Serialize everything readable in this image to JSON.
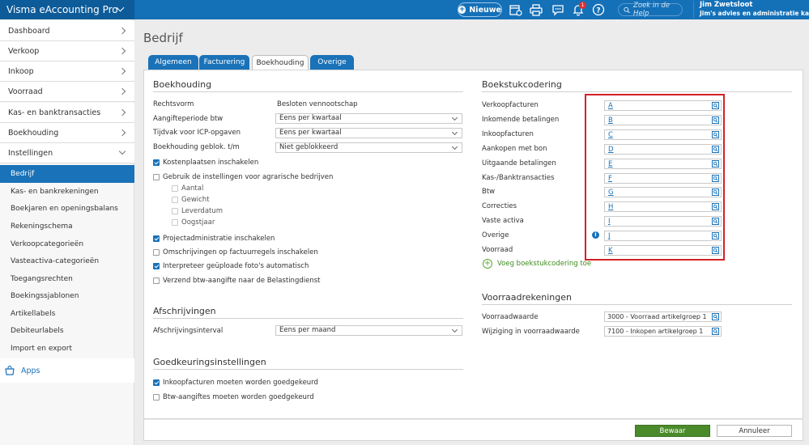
{
  "app": {
    "title": "Visma eAccounting Pro"
  },
  "topbar": {
    "new_label": "Nieuwe",
    "notification_count": "1",
    "search_placeholder": "Zoek in de Help",
    "user_name": "Jim Zwetsloot",
    "company": "Jim's advies en administratie kantoor"
  },
  "sidebar": {
    "top_items": [
      {
        "label": "Dashboard"
      },
      {
        "label": "Verkoop"
      },
      {
        "label": "Inkoop"
      },
      {
        "label": "Voorraad"
      },
      {
        "label": "Kas- en banktransacties"
      },
      {
        "label": "Boekhouding"
      },
      {
        "label": "Instellingen"
      }
    ],
    "sub_items": [
      {
        "label": "Bedrijf",
        "active": true
      },
      {
        "label": "Kas- en bankrekeningen"
      },
      {
        "label": "Boekjaren en openingsbalans"
      },
      {
        "label": "Rekeningschema"
      },
      {
        "label": "Verkoopcategorieën"
      },
      {
        "label": "Vasteactiva-categorieën"
      },
      {
        "label": "Toegangsrechten"
      },
      {
        "label": "Boekingssjablonen"
      },
      {
        "label": "Artikellabels"
      },
      {
        "label": "Debiteurlabels"
      },
      {
        "label": "Import en export"
      }
    ],
    "apps_label": "Apps"
  },
  "page": {
    "title": "Bedrijf",
    "tabs": [
      {
        "label": "Algemeen"
      },
      {
        "label": "Facturering"
      },
      {
        "label": "Boekhouding",
        "active": true
      },
      {
        "label": "Overige"
      }
    ]
  },
  "boekhouding": {
    "title": "Boekhouding",
    "rechtsvorm_label": "Rechtsvorm",
    "rechtsvorm_value": "Besloten vennootschap",
    "aangifte_label": "Aangifteperiode btw",
    "aangifte_value": "Eens per kwartaal",
    "icp_label": "Tijdvak voor ICP-opgaven",
    "icp_value": "Eens per kwartaal",
    "geblok_label": "Boekhouding geblok. t/m",
    "geblok_value": "Niet geblokkeerd",
    "checkboxes": [
      {
        "label": "Kostenplaatsen inschakelen",
        "checked": true
      },
      {
        "label": "Gebruik de instellingen voor agrarische bedrijven",
        "checked": false
      }
    ],
    "agrarisch_sub": [
      {
        "label": "Aantal"
      },
      {
        "label": "Gewicht"
      },
      {
        "label": "Leverdatum"
      },
      {
        "label": "Oogstjaar"
      }
    ],
    "checkboxes2": [
      {
        "label": "Projectadministratie inschakelen",
        "checked": true
      },
      {
        "label": "Omschrijvingen op factuurregels inschakelen",
        "checked": false
      },
      {
        "label": "Interpreteer geüploade foto's automatisch",
        "checked": true
      },
      {
        "label": "Verzend btw-aangifte naar de Belastingdienst",
        "checked": false
      }
    ]
  },
  "afschrijvingen": {
    "title": "Afschrijvingen",
    "interval_label": "Afschrijvingsinterval",
    "interval_value": "Eens per maand"
  },
  "goedkeuring": {
    "title": "Goedkeuringsinstellingen",
    "items": [
      {
        "label": "Inkoopfacturen moeten worden goedgekeurd",
        "checked": true
      },
      {
        "label": "Btw-aangiftes moeten worden goedgekeurd",
        "checked": false
      }
    ]
  },
  "boekstukcodering": {
    "title": "Boekstukcodering",
    "rows": [
      {
        "label": "Verkoopfacturen",
        "code": "A"
      },
      {
        "label": "Inkomende betalingen",
        "code": "B"
      },
      {
        "label": "Inkoopfacturen",
        "code": "C"
      },
      {
        "label": "Aankopen met bon",
        "code": "D"
      },
      {
        "label": "Uitgaande betalingen",
        "code": "E"
      },
      {
        "label": "Kas-/Banktransacties",
        "code": "F"
      },
      {
        "label": "Btw",
        "code": "G"
      },
      {
        "label": "Correcties",
        "code": "H"
      },
      {
        "label": "Vaste activa",
        "code": "I"
      },
      {
        "label": "Overige",
        "code": "J"
      },
      {
        "label": "Voorraad",
        "code": "K"
      }
    ],
    "add_label": "Voeg boekstukcodering toe"
  },
  "voorraadrekeningen": {
    "title": "Voorraadrekeningen",
    "rows": [
      {
        "label": "Voorraadwaarde",
        "value": "3000 - Voorraad artikelgroep 1"
      },
      {
        "label": "Wijziging in voorraadwaarde",
        "value": "7100 - Inkopen artikelgroep 1"
      }
    ]
  },
  "footer": {
    "save_label": "Bewaar",
    "cancel_label": "Annuleer"
  },
  "colors": {
    "brand": "#1470b7",
    "save": "#4a8a2a",
    "highlight": "#d42127"
  }
}
